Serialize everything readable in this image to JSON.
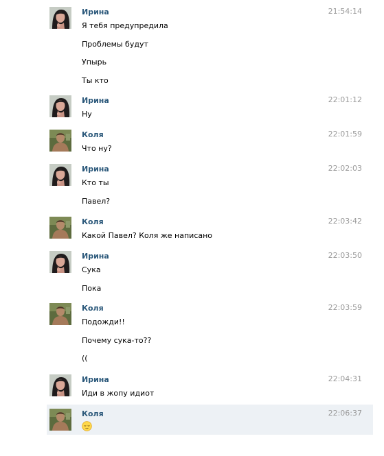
{
  "messages": [
    {
      "author": "Ирина",
      "avatar": "irina-avatar",
      "time": "21:54:14",
      "lines": [
        "Я тебя предупредила",
        "Проблемы будут",
        "Упырь",
        "Ты кто"
      ]
    },
    {
      "author": "Ирина",
      "avatar": "irina-avatar",
      "time": "22:01:12",
      "lines": [
        "Ну"
      ]
    },
    {
      "author": "Коля",
      "avatar": "kolya-avatar",
      "time": "22:01:59",
      "lines": [
        "Что ну?"
      ]
    },
    {
      "author": "Ирина",
      "avatar": "irina-avatar",
      "time": "22:02:03",
      "lines": [
        "Кто ты",
        "Павел?"
      ]
    },
    {
      "author": "Коля",
      "avatar": "kolya-avatar",
      "time": "22:03:42",
      "lines": [
        "Какой Павел? Коля же написано"
      ]
    },
    {
      "author": "Ирина",
      "avatar": "irina-avatar",
      "time": "22:03:50",
      "lines": [
        "Сука",
        "Пока"
      ]
    },
    {
      "author": "Коля",
      "avatar": "kolya-avatar",
      "time": "22:03:59",
      "lines": [
        "Подожди!!",
        "Почему сука-то??",
        "(("
      ]
    },
    {
      "author": "Ирина",
      "avatar": "irina-avatar",
      "time": "22:04:31",
      "lines": [
        "Иди в жопу идиот"
      ]
    },
    {
      "author": "Коля",
      "avatar": "kolya-avatar",
      "time": "22:06:37",
      "lines": [],
      "emoji": "relieved-face-icon",
      "highlighted": true
    }
  ],
  "colors": {
    "author": "#2b587a",
    "time": "#999999",
    "highlight": "#edf1f5"
  }
}
